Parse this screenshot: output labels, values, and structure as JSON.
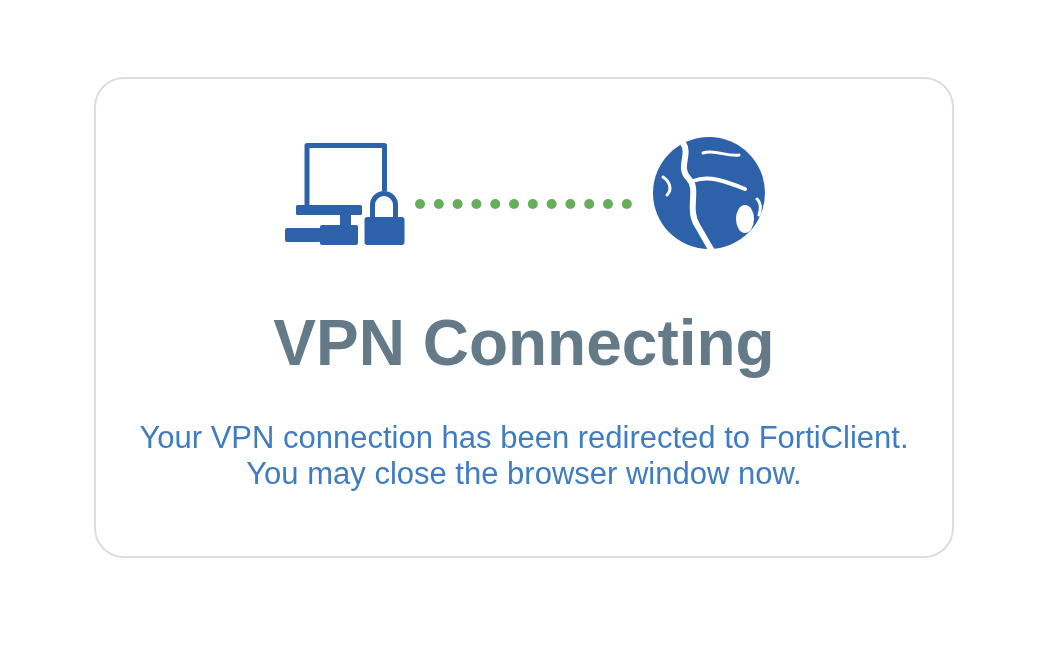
{
  "card": {
    "title": "VPN Connecting",
    "message": [
      "Your VPN connection has been redirected to FortiClient.",
      "You may close the browser window now."
    ]
  }
}
